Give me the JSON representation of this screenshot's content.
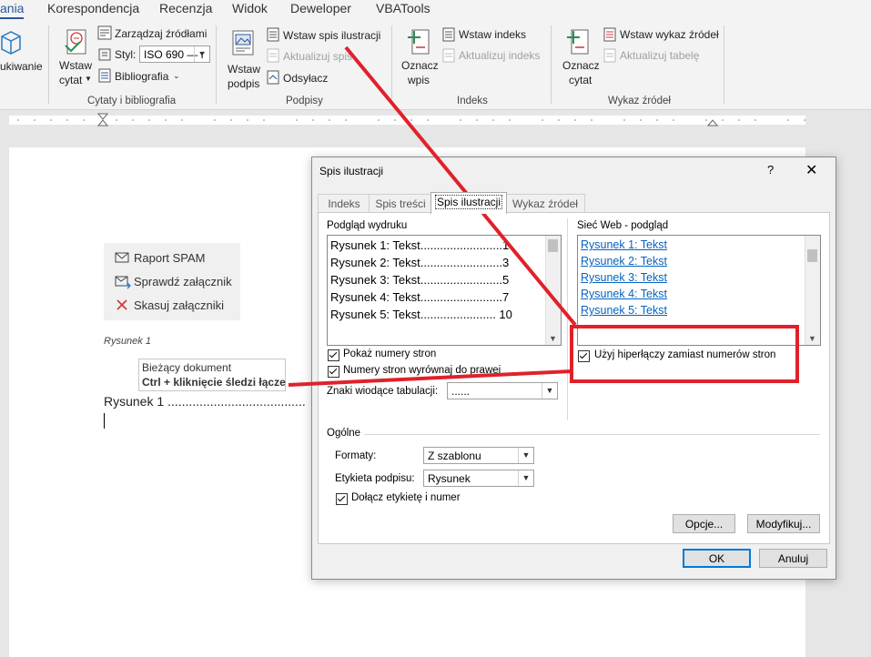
{
  "ribbon_tabs": {
    "t0": "ania",
    "t1": "Korespondencja",
    "t2": "Recenzja",
    "t3": "Widok",
    "t4": "Deweloper",
    "t5": "VBATools"
  },
  "ribbon": {
    "g0_label": "ukiwanie",
    "citations": {
      "insert_citation_1": "Wstaw",
      "insert_citation_2": "cytat",
      "manage_sources": "Zarządzaj źródłami",
      "style_label": "Styl:",
      "style_value": "ISO 690 — r",
      "bibliography": "Bibliografia",
      "group": "Cytaty i bibliografia"
    },
    "captions": {
      "insert_caption_1": "Wstaw",
      "insert_caption_2": "podpis",
      "insert_tof": "Wstaw spis ilustracji",
      "update_table": "Aktualizuj spis",
      "cross_reference": "Odsyłacz",
      "group": "Podpisy"
    },
    "index": {
      "mark_entry_1": "Oznacz",
      "mark_entry_2": "wpis",
      "insert_index": "Wstaw indeks",
      "update_index": "Aktualizuj indeks",
      "group": "Indeks"
    },
    "toa": {
      "mark_citation_1": "Oznacz",
      "mark_citation_2": "cytat",
      "insert_toa": "Wstaw wykaz źródeł",
      "update_table": "Aktualizuj tabelę",
      "group": "Wykaz źródeł"
    }
  },
  "document": {
    "addin": {
      "report_spam": "Raport SPAM",
      "check_attachment": "Sprawdź załącznik",
      "delete_attachments": "Skasuj załączniki"
    },
    "caption": "Rysunek 1",
    "tooltip_line1": "Bieżący dokument",
    "tooltip_line2": "Ctrl + kliknięcie śledzi łącze",
    "toc_line": "Rysunek 1 ......................................."
  },
  "dialog": {
    "title": "Spis ilustracji",
    "help": "?",
    "close": "✕",
    "tabs": {
      "index": "Indeks",
      "toc": "Spis treści",
      "tof": "Spis ilustracji",
      "toa": "Wykaz źródeł"
    },
    "print_preview_label": "Podgląd wydruku",
    "print_preview": [
      "Rysunek 1: Tekst.........................1",
      "Rysunek 2: Tekst.........................3",
      "Rysunek 3: Tekst.........................5",
      "Rysunek 4: Tekst.........................7",
      "Rysunek 5: Tekst....................... 10"
    ],
    "web_preview_label": "Sieć Web - podgląd",
    "web_preview": [
      "Rysunek 1: Tekst",
      "Rysunek 2: Tekst",
      "Rysunek 3: Tekst",
      "Rysunek 4: Tekst",
      "Rysunek 5: Tekst"
    ],
    "show_page_numbers": "Pokaż numery stron",
    "right_align": "Numery stron wyrównaj do prawej",
    "tab_leader_label": "Znaki wiodące tabulacji:",
    "tab_leader_value": "......",
    "use_hyperlinks": "Użyj hiperłączy zamiast numerów stron",
    "general_label": "Ogólne",
    "formats_label": "Formaty:",
    "formats_value": "Z szablonu",
    "caption_label_label": "Etykieta podpisu:",
    "caption_label_value": "Rysunek",
    "include_label": "Dołącz etykietę i numer",
    "options_button": "Opcje...",
    "modify_button": "Modyfikuj...",
    "ok_button": "OK",
    "cancel_button": "Anuluj"
  },
  "colors": {
    "annotation": "#e0212b",
    "hyperlink": "#0563c1",
    "accent": "#2b579a"
  }
}
